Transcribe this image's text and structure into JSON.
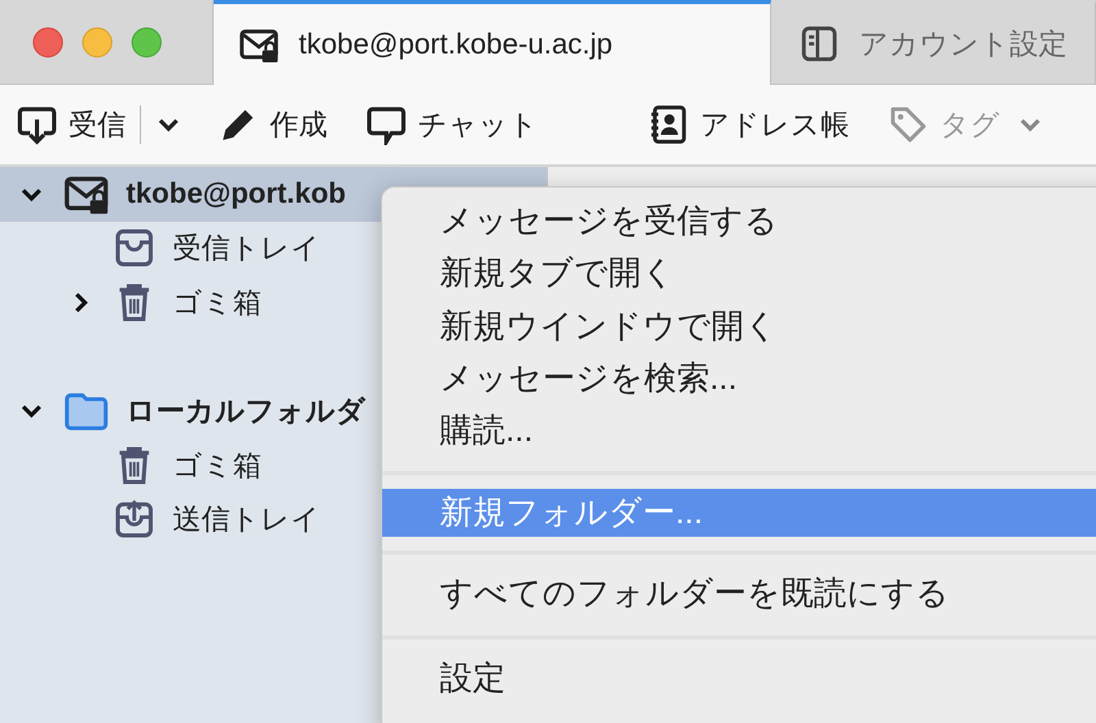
{
  "window": {
    "controls": [
      {
        "kind": "close"
      },
      {
        "kind": "minimize"
      },
      {
        "kind": "zoom"
      }
    ]
  },
  "tabs": [
    {
      "label": "tkobe@port.kobe-u.ac.jp",
      "kind": "mail",
      "selected": true
    },
    {
      "label": "アカウント設定",
      "kind": "settings",
      "selected": false
    }
  ],
  "toolbar": [
    {
      "label": "受信",
      "kind": "get",
      "dropdown": true,
      "disabled": false
    },
    {
      "label": "作成",
      "kind": "write",
      "dropdown": false,
      "disabled": false
    },
    {
      "label": "チャット",
      "kind": "chat",
      "dropdown": false,
      "disabled": false
    },
    {
      "label": "アドレス帳",
      "kind": "contacts",
      "dropdown": false,
      "disabled": false
    },
    {
      "label": "タグ",
      "kind": "tag",
      "dropdown": true,
      "disabled": true
    }
  ],
  "folder_tree": [
    {
      "label": "tkobe@port.kob",
      "kind": "account",
      "expanded": true,
      "selected": true,
      "children": [
        {
          "label": "受信トレイ",
          "kind": "inbox",
          "selected": false
        },
        {
          "label": "ゴミ箱",
          "kind": "trash",
          "expanded": false,
          "selected": false
        }
      ]
    },
    {
      "label": "ローカルフォルダ",
      "kind": "local",
      "expanded": true,
      "selected": false,
      "children": [
        {
          "label": "ゴミ箱",
          "kind": "trash",
          "selected": false
        },
        {
          "label": "送信トレイ",
          "kind": "outbox",
          "selected": false
        }
      ]
    }
  ],
  "context_menu": [
    {
      "kind": "item",
      "label": "メッセージを受信する",
      "selected": false
    },
    {
      "kind": "item",
      "label": "新規タブで開く",
      "selected": false
    },
    {
      "kind": "item",
      "label": "新規ウインドウで開く",
      "selected": false
    },
    {
      "kind": "item",
      "label": "メッセージを検索...",
      "selected": false
    },
    {
      "kind": "item",
      "label": "購読...",
      "selected": false
    },
    {
      "kind": "separator"
    },
    {
      "kind": "item",
      "label": "新規フォルダー...",
      "selected": true
    },
    {
      "kind": "separator"
    },
    {
      "kind": "item",
      "label": "すべてのフォルダーを既読にする",
      "selected": false
    },
    {
      "kind": "separator"
    },
    {
      "kind": "item",
      "label": "設定",
      "selected": false
    }
  ]
}
